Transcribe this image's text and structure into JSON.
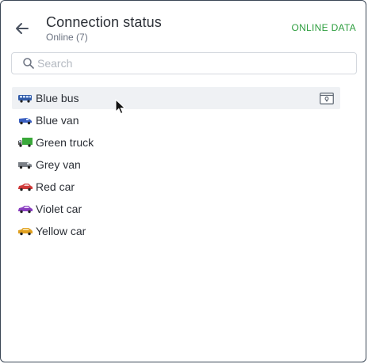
{
  "header": {
    "title": "Connection status",
    "subtitle": "Online (7)",
    "online_data_label": "ONLINE DATA"
  },
  "search": {
    "placeholder": "Search",
    "value": ""
  },
  "vehicles": [
    {
      "label": "Blue bus",
      "icon": "bus-icon",
      "color": "#2f5aa8"
    },
    {
      "label": "Blue van",
      "icon": "van-icon",
      "color": "#3a5fc0"
    },
    {
      "label": "Green truck",
      "icon": "truck-icon",
      "color": "#3aa83a"
    },
    {
      "label": "Grey van",
      "icon": "van-icon",
      "color": "#7a7f86"
    },
    {
      "label": "Red car",
      "icon": "car-icon",
      "color": "#d03a3a"
    },
    {
      "label": "Violet car",
      "icon": "car-icon",
      "color": "#8a3ec0"
    },
    {
      "label": "Yellow car",
      "icon": "car-icon",
      "color": "#e0a020"
    }
  ],
  "colors": {
    "accent_green": "#2e9e3f",
    "border": "#3a4655",
    "active_row": "#eff1f4"
  }
}
